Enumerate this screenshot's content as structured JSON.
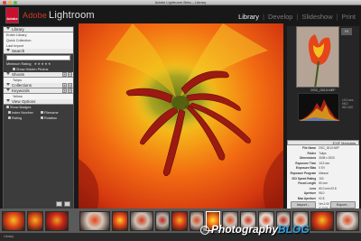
{
  "window": {
    "title": "Adobe Lightroom Beta – Library"
  },
  "app": {
    "logo_mark": "Adobe",
    "name_prefix": "Adobe",
    "name": "Lightroom"
  },
  "modules": [
    "Library",
    "Develop",
    "Slideshow",
    "Print"
  ],
  "left_panel": {
    "library": {
      "header": "Library",
      "items": [
        "Entire Library",
        "Quick Collection",
        "Last Import"
      ]
    },
    "find": {
      "header": "Search",
      "rating_label": "Minimum Rating",
      "stars": "★★★★★",
      "option": "Show Hidden Photos"
    },
    "shoots": {
      "header": "Shoots",
      "items": [
        "Tulips"
      ]
    },
    "collections": {
      "header": "Collections"
    },
    "keywords": {
      "header": "Keywords",
      "items": [
        "Yellow"
      ]
    },
    "view_options": {
      "header": "View Options",
      "show_badges": "Show Badges",
      "badges": [
        "Index Number",
        "Filename",
        "Rating",
        "Rotation"
      ]
    }
  },
  "navigator": {
    "badge": "Fit"
  },
  "histogram": {
    "filename": "DSC_0013.NEF",
    "side_labels": [
      "1/13 sec",
      "f/8.0",
      "ISO 100"
    ]
  },
  "metadata": {
    "header": "EXIF Metadata",
    "rows": [
      {
        "key": "File Name",
        "value": "DSC_0013.NEF"
      },
      {
        "key": "Folder",
        "value": "Tulips"
      },
      {
        "key": "Dimensions",
        "value": "3008 x 2000"
      },
      {
        "key": "Exposure Time",
        "value": "1/13 sec"
      },
      {
        "key": "Exposure Bias",
        "value": "0 EV"
      },
      {
        "key": "Exposure Program",
        "value": "Manual"
      },
      {
        "key": "ISO Speed Rating",
        "value": "100"
      },
      {
        "key": "Focal Length",
        "value": "60 mm"
      },
      {
        "key": "Lens",
        "value": "60.0 mm f/2.8"
      },
      {
        "key": "Aperture",
        "value": "f/8.0"
      },
      {
        "key": "Max Aperture",
        "value": "f/2.8"
      },
      {
        "key": "Software",
        "value": "Ver.2.00"
      },
      {
        "key": "Copyright",
        "value": "© 2006 Johanna Bird"
      }
    ],
    "import_label": "Import...",
    "export_label": "Export..."
  },
  "status": {
    "text": "Library"
  },
  "watermark": {
    "symbol": "©",
    "text_a": "Photography",
    "text_b": "BLOG"
  },
  "colors": {
    "accent": "#d23a2a",
    "petal_red": "#9c1a12",
    "flower_orange": "#f26a12",
    "flower_yellow": "#f5d016",
    "watermark_blue": "#2aa3e8"
  }
}
